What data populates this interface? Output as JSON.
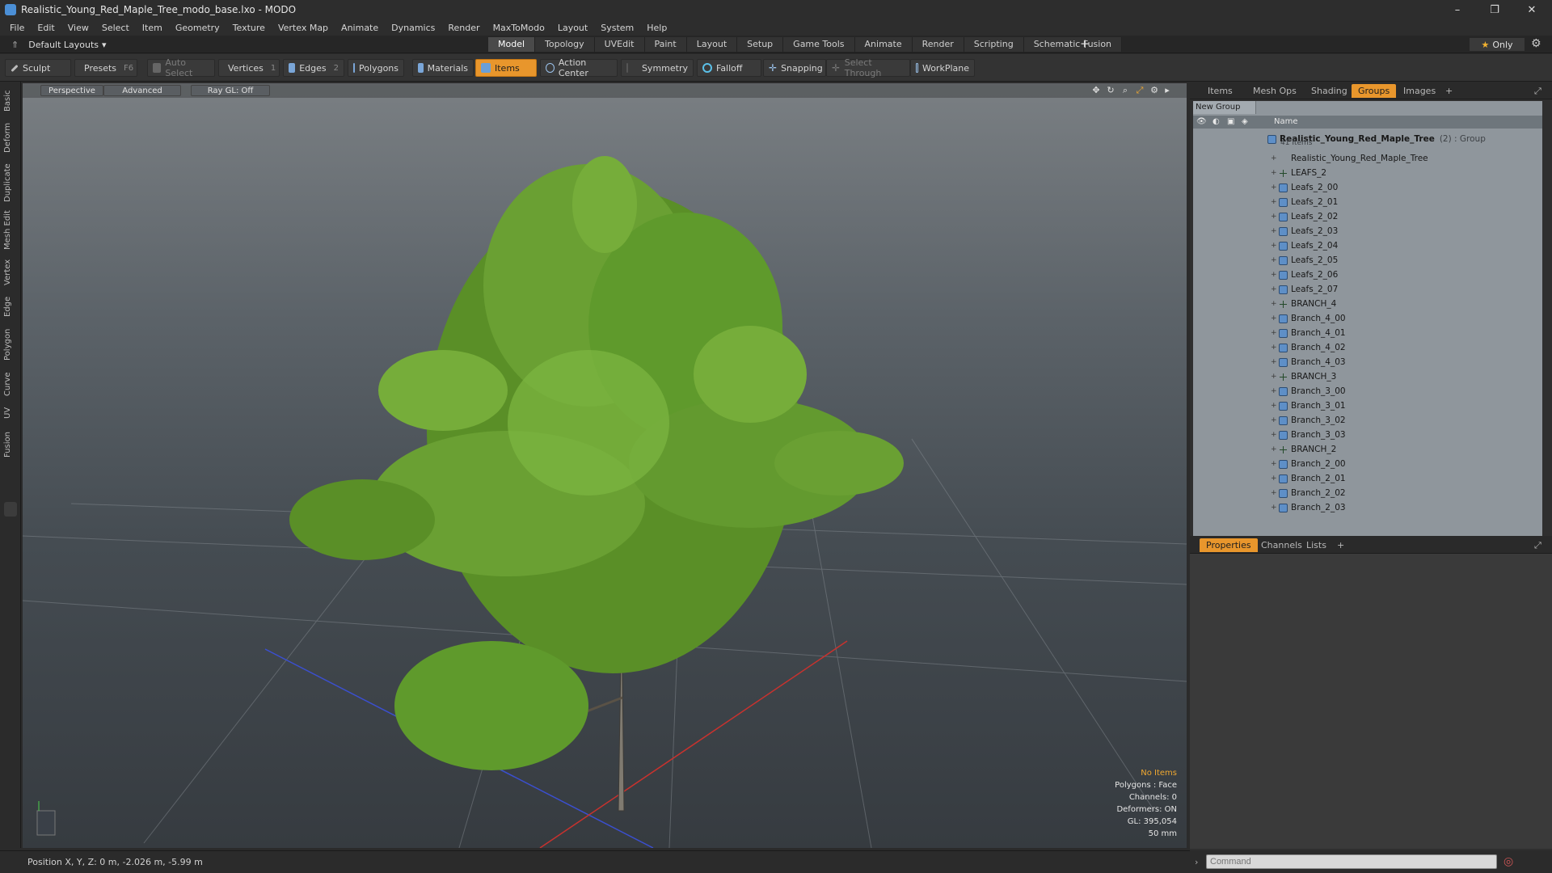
{
  "window": {
    "title": "Realistic_Young_Red_Maple_Tree_modo_base.lxo - MODO"
  },
  "menu": [
    "File",
    "Edit",
    "View",
    "Select",
    "Item",
    "Geometry",
    "Texture",
    "Vertex Map",
    "Animate",
    "Dynamics",
    "Render",
    "MaxToModo",
    "Layout",
    "System",
    "Help"
  ],
  "layoutbar": {
    "layouts_label": "Default Layouts",
    "tabs": [
      "Model",
      "Topology",
      "UVEdit",
      "Paint",
      "Layout",
      "Setup",
      "Game Tools",
      "Animate",
      "Render",
      "Scripting",
      "Schematic Fusion"
    ],
    "active_tab": "Model",
    "only_label": "Only"
  },
  "toolbar": {
    "sculpt": "Sculpt",
    "presets": "Presets",
    "presets_key": "F6",
    "auto_select": "Auto Select",
    "vertices": "Vertices",
    "vertices_count": "1",
    "edges": "Edges",
    "edges_count": "2",
    "polygons": "Polygons",
    "materials": "Materials",
    "items": "Items",
    "action_center": "Action Center",
    "symmetry": "Symmetry",
    "falloff": "Falloff",
    "snapping": "Snapping",
    "select_through": "Select Through",
    "workplane": "WorkPlane"
  },
  "left_tabs": [
    "Basic",
    "Deform",
    "Duplicate",
    "Mesh Edit",
    "Vertex",
    "Edge",
    "Polygon",
    "Curve",
    "UV",
    "Fusion"
  ],
  "viewport": {
    "perspective": "Perspective",
    "advanced": "Advanced",
    "raygl": "Ray GL: Off",
    "info": {
      "no_items": "No Items",
      "polygons": "Polygons : Face",
      "channels": "Channels: 0",
      "deformers": "Deformers: ON",
      "gl": "GL: 395,054",
      "focal": "50 mm"
    }
  },
  "status": {
    "position": "Position X, Y, Z:  0 m, -2.026 m, -5.99 m"
  },
  "right_panel": {
    "tabs": [
      "Items",
      "Mesh Ops",
      "Shading",
      "Groups",
      "Images"
    ],
    "active_tab": "Groups",
    "new_group": "New Group",
    "column_name": "Name",
    "group": {
      "name": "Realistic_Young_Red_Maple_Tree",
      "suffix": "(2) : Group",
      "count": "41 Items"
    },
    "items": [
      {
        "name": "Realistic_Young_Red_Maple_Tree",
        "type": "none"
      },
      {
        "name": "LEAFS_2",
        "type": "locator"
      },
      {
        "name": "Leafs_2_00",
        "type": "mesh"
      },
      {
        "name": "Leafs_2_01",
        "type": "mesh"
      },
      {
        "name": "Leafs_2_02",
        "type": "mesh"
      },
      {
        "name": "Leafs_2_03",
        "type": "mesh"
      },
      {
        "name": "Leafs_2_04",
        "type": "mesh"
      },
      {
        "name": "Leafs_2_05",
        "type": "mesh"
      },
      {
        "name": "Leafs_2_06",
        "type": "mesh"
      },
      {
        "name": "Leafs_2_07",
        "type": "mesh"
      },
      {
        "name": "BRANCH_4",
        "type": "locator"
      },
      {
        "name": "Branch_4_00",
        "type": "mesh"
      },
      {
        "name": "Branch_4_01",
        "type": "mesh"
      },
      {
        "name": "Branch_4_02",
        "type": "mesh"
      },
      {
        "name": "Branch_4_03",
        "type": "mesh"
      },
      {
        "name": "BRANCH_3",
        "type": "locator"
      },
      {
        "name": "Branch_3_00",
        "type": "mesh"
      },
      {
        "name": "Branch_3_01",
        "type": "mesh"
      },
      {
        "name": "Branch_3_02",
        "type": "mesh"
      },
      {
        "name": "Branch_3_03",
        "type": "mesh"
      },
      {
        "name": "BRANCH_2",
        "type": "locator"
      },
      {
        "name": "Branch_2_00",
        "type": "mesh"
      },
      {
        "name": "Branch_2_01",
        "type": "mesh"
      },
      {
        "name": "Branch_2_02",
        "type": "mesh"
      },
      {
        "name": "Branch_2_03",
        "type": "mesh"
      }
    ],
    "bottom_tabs": [
      "Properties",
      "Channels",
      "Lists"
    ],
    "bottom_active": "Properties",
    "command_placeholder": "Command"
  },
  "colors": {
    "accent": "#e8962c",
    "leaf": "#6aa033",
    "viewport_top": "#7a7f83"
  }
}
